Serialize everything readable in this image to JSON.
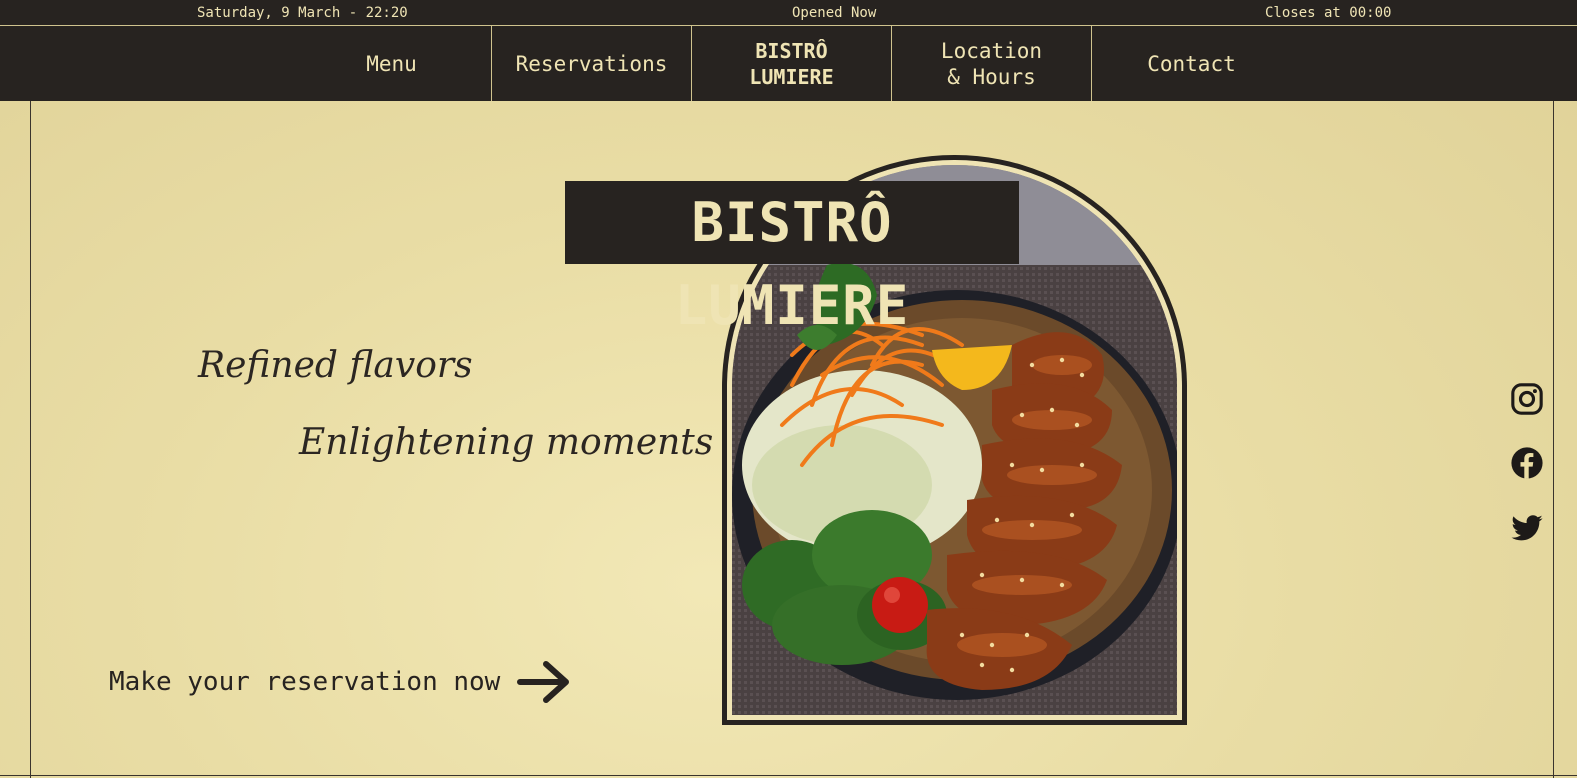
{
  "topbar": {
    "datetime": "Saturday, 9 March - 22:20",
    "status": "Opened Now",
    "closing": "Closes at 00:00"
  },
  "nav": {
    "menu": "Menu",
    "reservations": "Reservations",
    "brand": "BISTRÔ\nLUMIERE",
    "location": "Location\n& Hours",
    "contact": "Contact"
  },
  "hero": {
    "title": "BISTRÔ LUMIERE",
    "tagline_1": "Refined flavors",
    "tagline_2": "Enlightening moments",
    "cta": "Make your reservation now",
    "cta_icon": "arrow-right-icon",
    "image": "grilled chicken with sesame, spinach salad, shredded carrots and lemon"
  },
  "social": [
    {
      "name": "instagram-icon"
    },
    {
      "name": "facebook-icon"
    },
    {
      "name": "twitter-icon"
    }
  ],
  "colors": {
    "dark": "#272320",
    "cream": "#efe4b4",
    "background": "#e9dda5"
  }
}
